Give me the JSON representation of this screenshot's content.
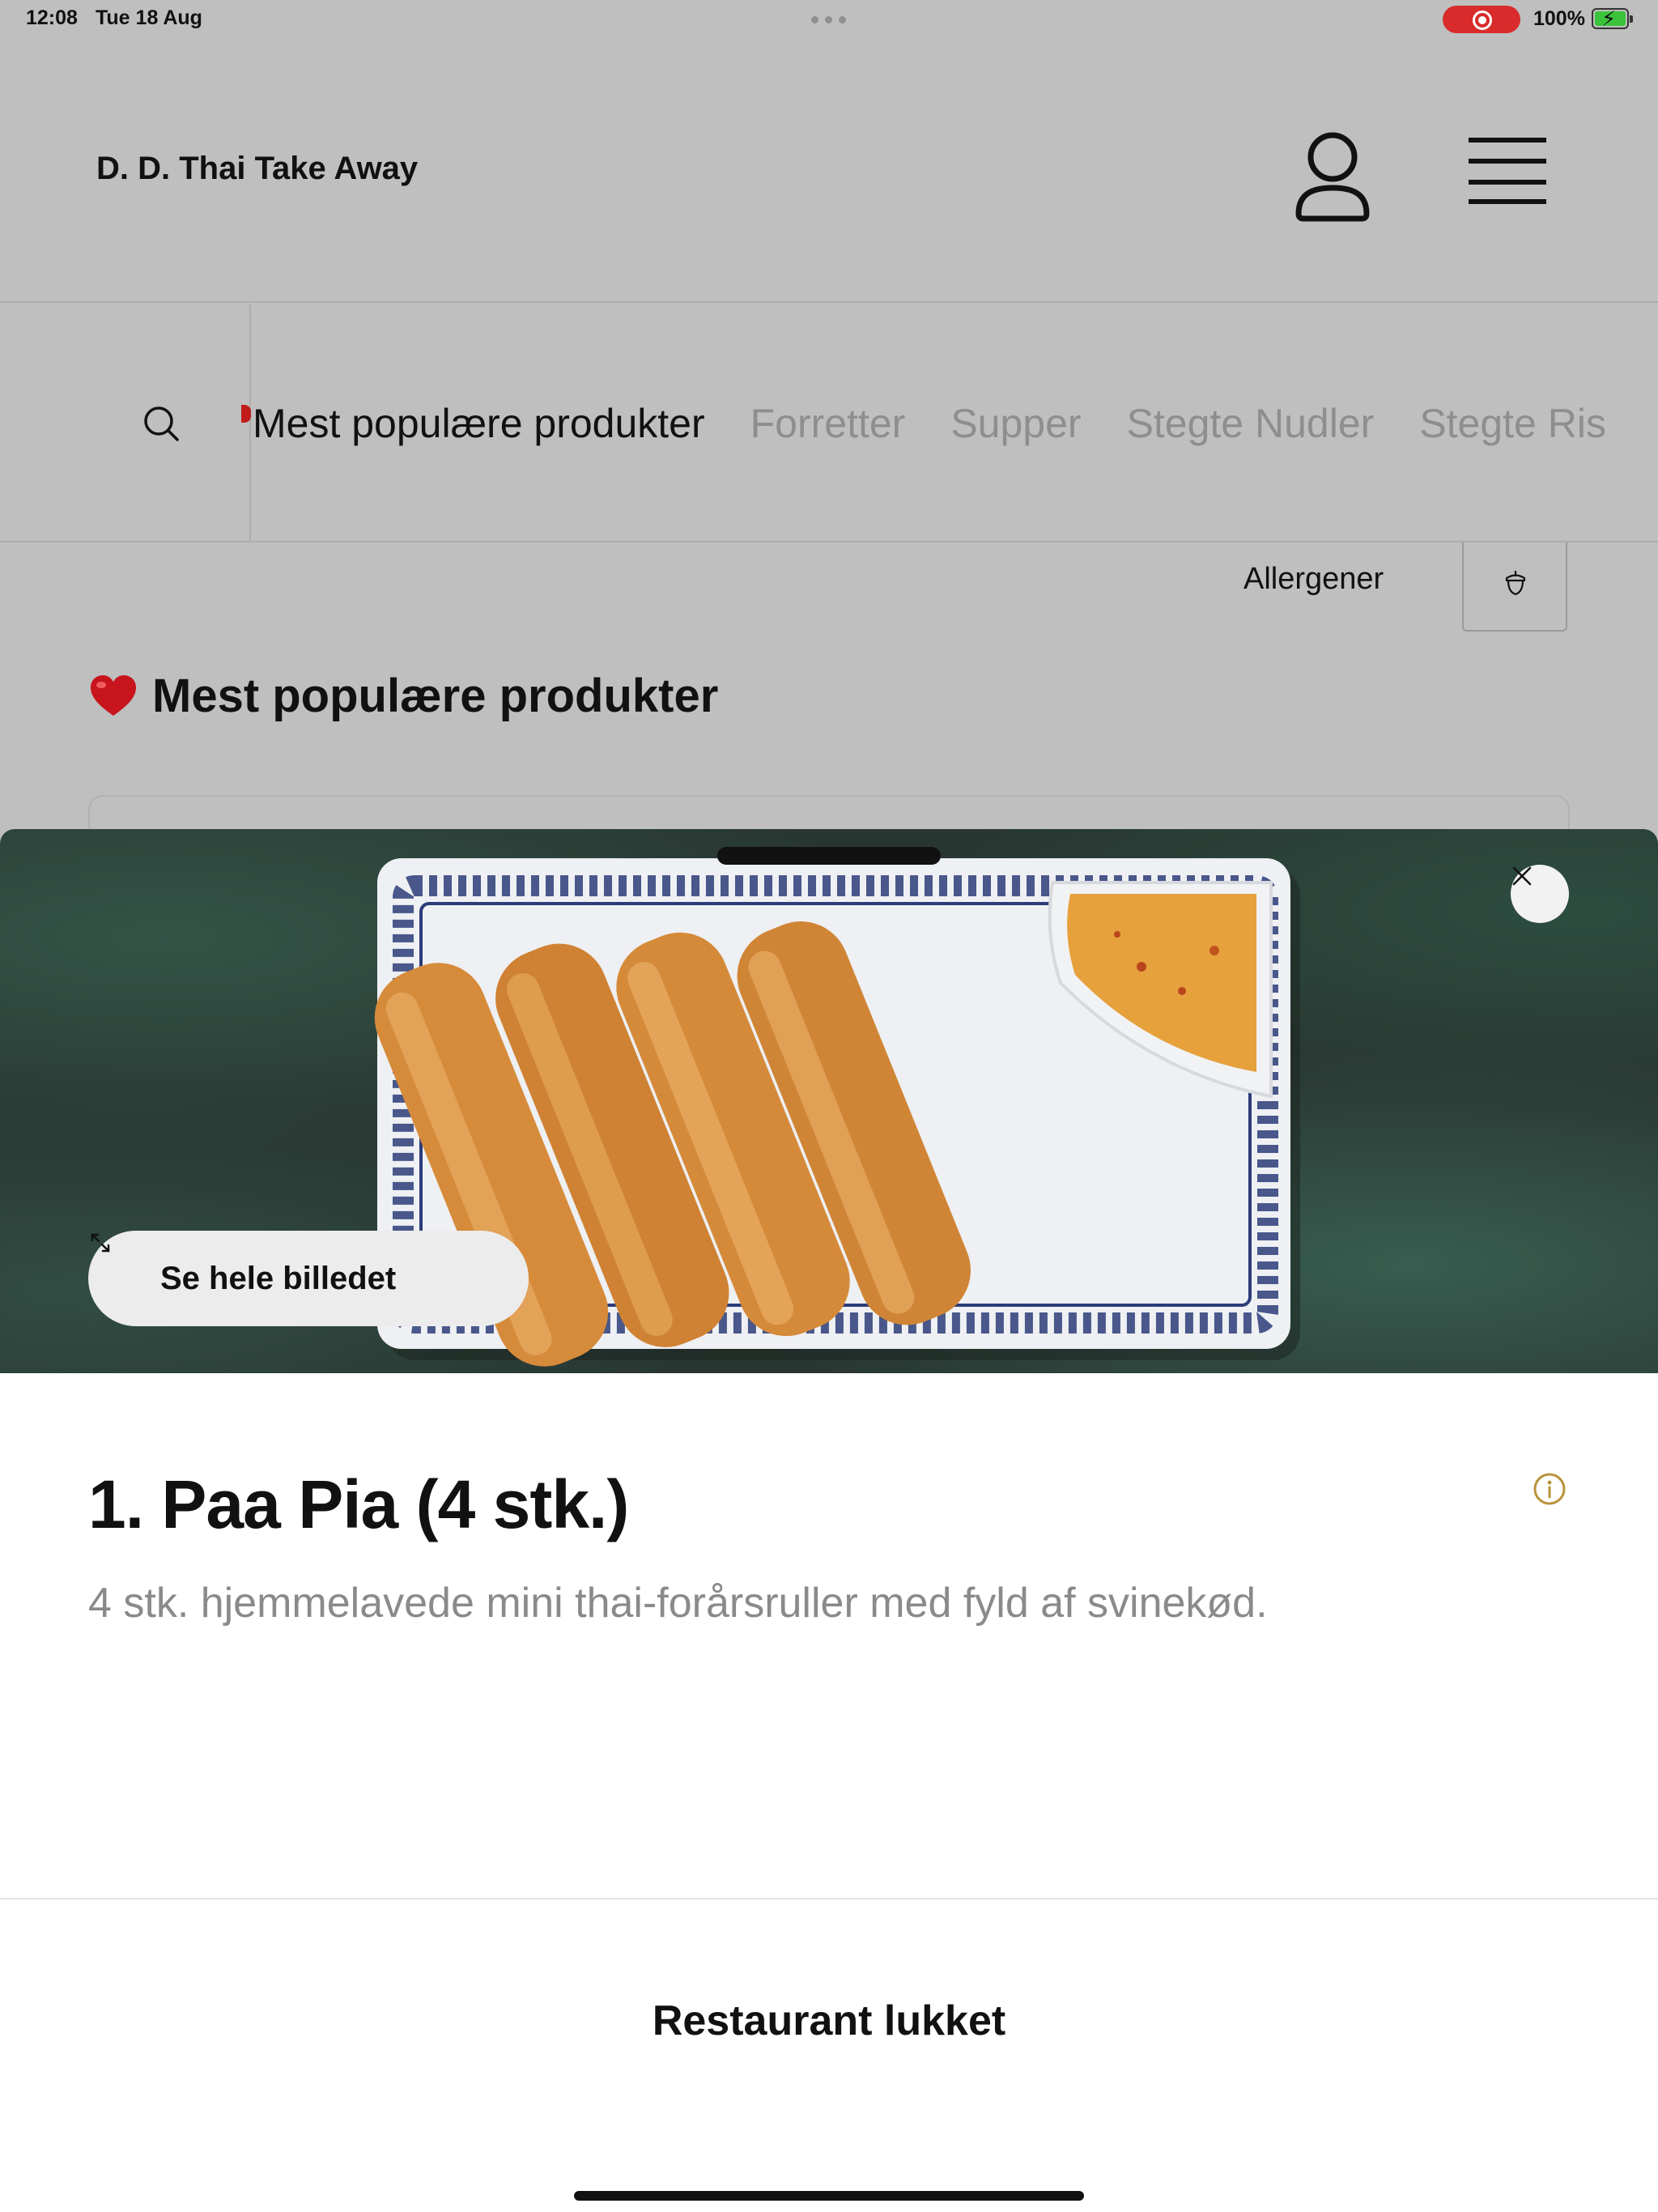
{
  "status_bar": {
    "time": "12:08",
    "date": "Tue 18 Aug",
    "battery": "100%"
  },
  "header": {
    "brand": "D. D. Thai Take Away",
    "icons": [
      "user-icon",
      "menu-icon"
    ]
  },
  "categories": {
    "tabs": [
      {
        "label": "Mest populære produkter",
        "active": true
      },
      {
        "label": "Forretter",
        "active": false
      },
      {
        "label": "Supper",
        "active": false
      },
      {
        "label": "Stegte Nudler",
        "active": false
      },
      {
        "label": "Stegte Ris",
        "active": false
      }
    ]
  },
  "filter": {
    "allergen_label": "Allergener"
  },
  "section": {
    "title": "Mest populære produkter"
  },
  "sheet": {
    "view_photo_label": "Se hele billedet",
    "product_title": "1. Paa Pia (4 stk.)",
    "product_description": "4 stk. hjemmelavede mini thai-forårsruller med fyld af svinekød.",
    "closed_label": "Restaurant lukket"
  },
  "colors": {
    "overlay_gray": "#bfbfbf",
    "accent_red": "#d92b2b",
    "info_gold": "#b8923a",
    "muted_text": "#8a8a8a"
  }
}
